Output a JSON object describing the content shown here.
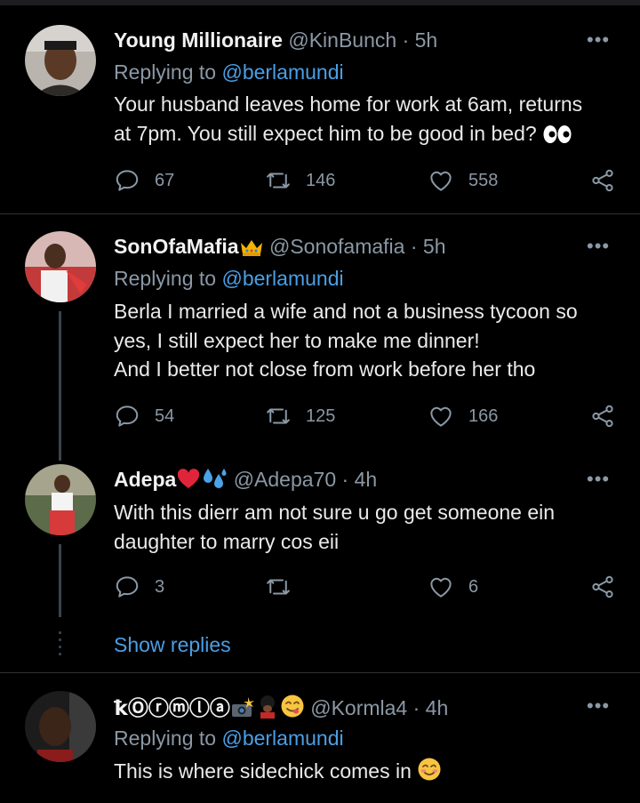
{
  "tweets": [
    {
      "name": "Young Millionaire",
      "handle": "@KinBunch",
      "time": "· 5h",
      "replying_label": "Replying to ",
      "replying_user": "@berlamundi",
      "lines": [
        "Your husband leaves home for work at 6am, returns",
        "at 7pm. You still expect him to be good in bed?"
      ],
      "replies": "67",
      "retweets": "146",
      "likes": "558"
    },
    {
      "name": "SonOfaMafia",
      "handle": "@Sonofamafia",
      "time": "· 5h",
      "replying_label": "Replying to ",
      "replying_user": "@berlamundi",
      "lines": [
        "Berla I married a wife and not a business tycoon so",
        "yes, I still expect her to make me dinner!",
        "And I better not close from work before her tho"
      ],
      "replies": "54",
      "retweets": "125",
      "likes": "166"
    },
    {
      "name": "Adepa",
      "handle": "@Adepa70",
      "time": "· 4h",
      "lines": [
        "With this dierr am not sure u go get someone ein",
        "daughter to marry cos eii"
      ],
      "replies": "3",
      "retweets": "",
      "likes": "6"
    },
    {
      "name": "ꝁⓄⓡⓜⓛⓐ",
      "handle": "@Kormla4",
      "time": "· 4h",
      "replying_label": "Replying to ",
      "replying_user": "@berlamundi",
      "lines": [
        "This is where sidechick comes in"
      ]
    }
  ],
  "show_replies": "Show replies",
  "more_glyph": "•••",
  "colors": {
    "link": "#4a9fe6",
    "muted": "#8b98a5",
    "background": "#000000"
  },
  "icons": [
    "reply-icon",
    "retweet-icon",
    "like-icon",
    "share-icon",
    "more-icon",
    "crown-emoji",
    "heart-emoji",
    "sweat-emoji",
    "camera-flash-emoji",
    "guard-emoji",
    "yum-emoji",
    "smiling-emoji",
    "eyes-emoji"
  ]
}
